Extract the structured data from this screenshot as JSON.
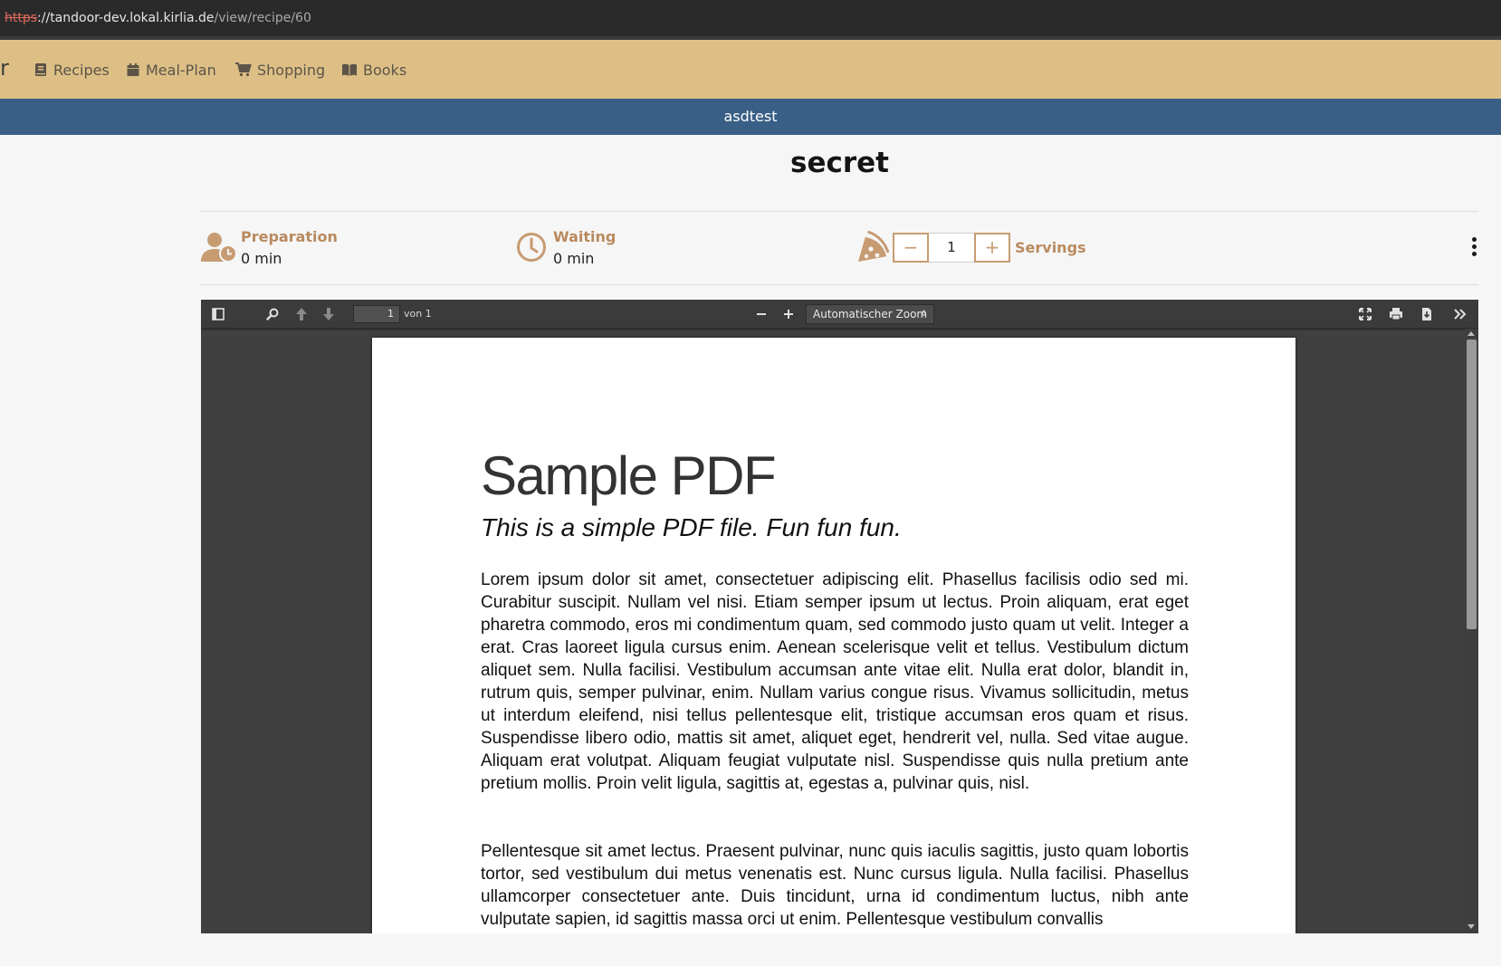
{
  "browser": {
    "url_scheme": "https",
    "url_host": "://tandoor-dev.lokal.kirlia.de",
    "url_path": "/view/recipe/60"
  },
  "nav": {
    "brand_fragment": "r",
    "items": [
      {
        "label": "Recipes",
        "icon": "book-icon"
      },
      {
        "label": "Meal-Plan",
        "icon": "calendar-icon"
      },
      {
        "label": "Shopping",
        "icon": "cart-icon"
      },
      {
        "label": "Books",
        "icon": "open-book-icon"
      }
    ]
  },
  "space_bar": {
    "label": "asdtest"
  },
  "recipe": {
    "title": "secret",
    "preparation": {
      "label": "Preparation",
      "value": "0 min"
    },
    "waiting": {
      "label": "Waiting",
      "value": "0 min"
    },
    "servings": {
      "label": "Servings",
      "value": "1",
      "minus": "−",
      "plus": "+"
    }
  },
  "pdf_viewer": {
    "page_number": "1",
    "page_of": "von 1",
    "zoom_label": "Automatischer Zoom",
    "zoom_out": "−",
    "zoom_in": "+"
  },
  "pdf": {
    "title": "Sample PDF",
    "subtitle": "This is a simple PDF file. Fun fun fun.",
    "paragraphs": [
      "Lorem ipsum dolor sit amet, consectetuer adipiscing elit. Phasellus facilisis odio sed mi. Curabitur suscipit. Nullam vel nisi. Etiam semper ipsum ut lectus. Proin aliquam, erat eget pharetra commodo, eros mi condimentum quam, sed commodo justo quam ut velit. Integer a erat. Cras laoreet ligula cursus enim. Aenean scelerisque velit et tellus. Vestibulum dictum aliquet sem. Nulla facilisi. Vestibulum accumsan ante vitae elit. Nulla erat dolor, blandit in, rutrum quis, semper pulvinar, enim. Nullam varius congue risus. Vivamus sollicitudin, metus ut interdum eleifend, nisi tellus pellentesque elit, tristique accumsan eros quam et risus. Suspendisse libero odio, mattis sit amet, aliquet eget, hendrerit vel, nulla. Sed vitae augue. Aliquam erat volutpat. Aliquam feugiat vulputate nisl. Suspendisse quis nulla pretium ante pretium mollis. Proin velit ligula, sagittis at, egestas a, pulvinar quis, nisl.",
      "Pellentesque sit amet lectus. Praesent pulvinar, nunc quis iaculis sagittis, justo quam lobortis tortor, sed vestibulum dui metus venenatis est. Nunc cursus ligula. Nulla facilisi. Phasellus ullamcorper consectetuer ante. Duis tincidunt, urna id condimentum luctus, nibh ante vulputate sapien, id sagittis massa orci ut enim. Pellentesque vestibulum convallis"
    ]
  },
  "colors": {
    "navbar": "#ddbf86",
    "space_bar": "#3a5f86",
    "accent": "#c79c72",
    "label_accent": "#b98a5e"
  }
}
